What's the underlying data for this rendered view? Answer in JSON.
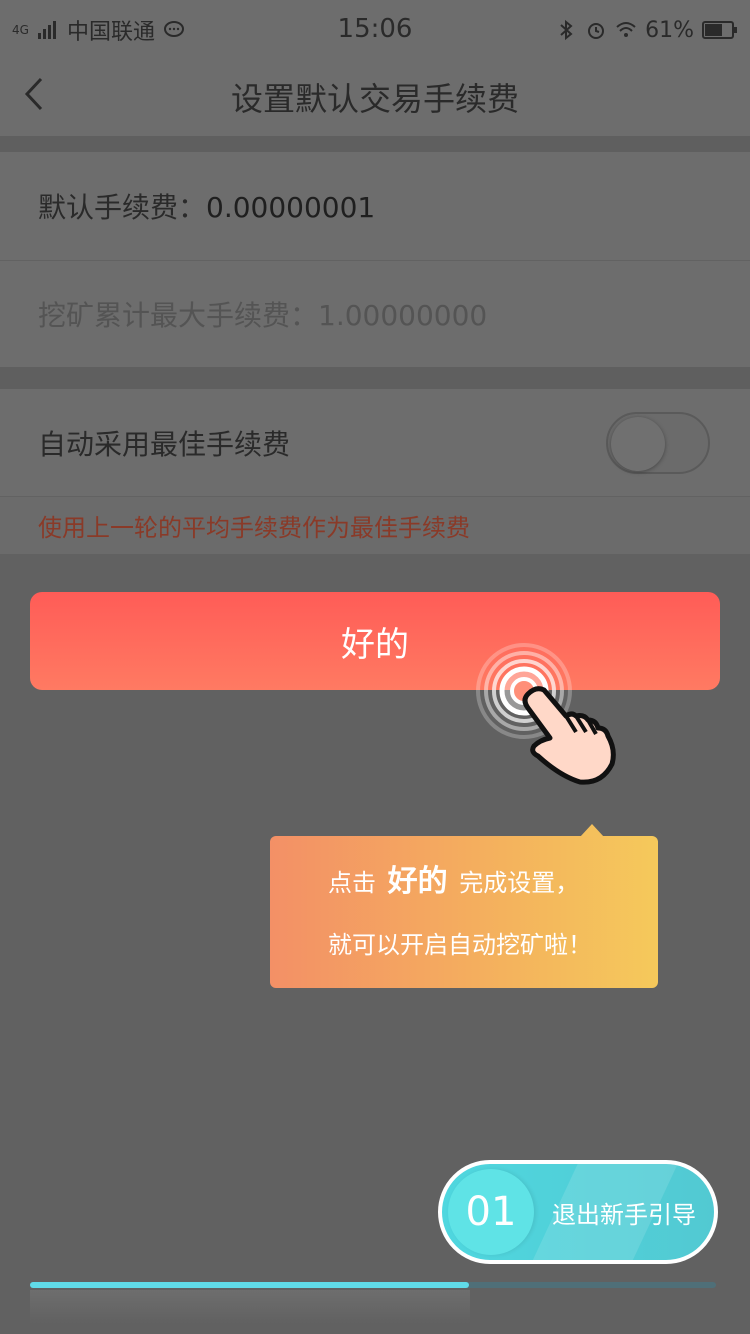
{
  "status_bar": {
    "network": "4G",
    "carrier": "中国联通",
    "time": "15:06",
    "battery": "61%"
  },
  "nav": {
    "title": "设置默认交易手续费"
  },
  "settings": {
    "default_fee_label": "默认手续费：",
    "default_fee_value": "0.00000001",
    "max_fee_label": "挖矿累计最大手续费：",
    "max_fee_value": "1.00000000",
    "auto_best_fee_label": "自动采用最佳手续费",
    "auto_best_fee_enabled": false,
    "hint": "使用上一轮的平均手续费作为最佳手续费"
  },
  "ok_button": {
    "label": "好的"
  },
  "tooltip": {
    "prefix": "点击",
    "highlight": "好的",
    "suffix": "完成设置，",
    "line2": "就可以开启自动挖矿啦！"
  },
  "guide": {
    "step": "01",
    "exit_label": "退出新手引导",
    "progress": 0.64
  },
  "colors": {
    "accent_red": "#ff5c57",
    "accent_cyan": "#52c9d2",
    "tooltip_orange": "#f39066",
    "hint_red": "#8a3a28"
  }
}
